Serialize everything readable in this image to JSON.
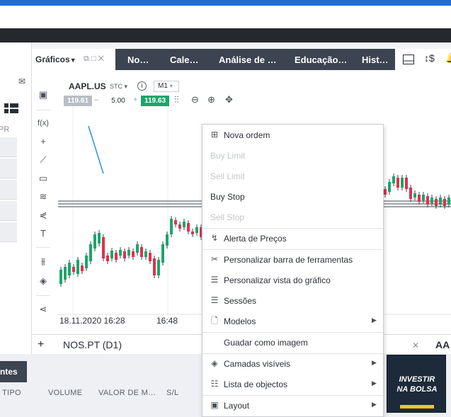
{
  "tabs": {
    "graficos": "Gráficos",
    "items": [
      "No…",
      "Cale…",
      "Análise de …",
      "Educação…",
      "Hist…"
    ]
  },
  "left_panel": {
    "label": "PR"
  },
  "chart": {
    "symbol": "AAPL.US",
    "instrument_type": "STC",
    "timeframe": "M1",
    "bid": "119.61",
    "quantity": "5.00",
    "ask": "119.63",
    "x_labels": [
      "18.11.2020 16:28",
      "16:48"
    ]
  },
  "bottom": {
    "chart_tab": "NOS.PT (D1)",
    "right_tab": "AA",
    "left_tab": "ntes",
    "columns": [
      "TIPO",
      "VOLUME",
      "VALOR DE M…",
      "S/L"
    ]
  },
  "context_menu": {
    "items": [
      {
        "label": "Nova ordem",
        "icon": "plus-square-icon",
        "disabled": false,
        "submenu": false
      },
      {
        "label": "Buy Limit",
        "icon": "",
        "disabled": true,
        "submenu": false
      },
      {
        "label": "Sell Limit",
        "icon": "",
        "disabled": true,
        "submenu": false
      },
      {
        "label": "Buy Stop",
        "icon": "",
        "disabled": false,
        "submenu": false
      },
      {
        "label": "Sell Stop",
        "icon": "",
        "disabled": true,
        "submenu": false
      },
      {
        "label": "Alerta de Preços",
        "icon": "alert-icon",
        "disabled": false,
        "submenu": false
      },
      {
        "label": "Personalizar barra de ferramentas",
        "icon": "tools-icon",
        "disabled": false,
        "submenu": false
      },
      {
        "label": "Personalizar vista do gráfico",
        "icon": "sliders-icon",
        "disabled": false,
        "submenu": false
      },
      {
        "label": "Sessões",
        "icon": "sessions-icon",
        "disabled": false,
        "submenu": false
      },
      {
        "label": "Modelos",
        "icon": "document-icon",
        "disabled": false,
        "submenu": true
      },
      {
        "label": "Guadar como imagem",
        "icon": "",
        "disabled": false,
        "submenu": false
      },
      {
        "label": "Camadas visíveis",
        "icon": "layers-icon",
        "disabled": false,
        "submenu": true
      },
      {
        "label": "Lista de objectos",
        "icon": "list-icon",
        "disabled": false,
        "submenu": true
      },
      {
        "label": "Layout",
        "icon": "layout-icon",
        "disabled": false,
        "submenu": true
      }
    ]
  },
  "logo": {
    "line1": "INVESTIR",
    "line2": "NA BOLSA"
  },
  "colors": {
    "up": "#1aa66a",
    "down": "#e0314b",
    "dark_tab": "#3b4450",
    "accent_blue": "#1f6fd1"
  }
}
